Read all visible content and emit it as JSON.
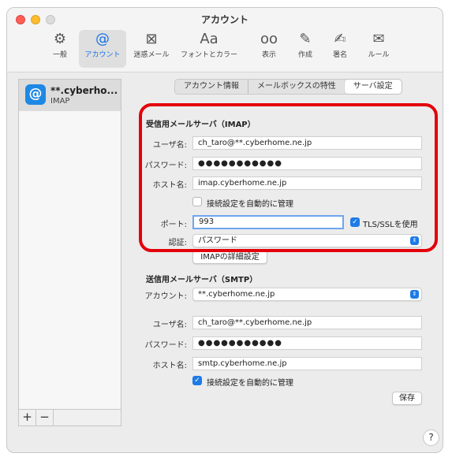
{
  "window": {
    "title": "アカウント"
  },
  "toolbar": {
    "items": [
      {
        "label": "一般",
        "icon": "gear-icon",
        "glyph": "⚙"
      },
      {
        "label": "アカウント",
        "icon": "at-icon",
        "glyph": "@"
      },
      {
        "label": "迷惑メール",
        "icon": "junk-mail-icon",
        "glyph": "⊠"
      },
      {
        "label": "フォントとカラー",
        "icon": "font-icon",
        "glyph": "Aa"
      },
      {
        "label": "表示",
        "icon": "glasses-icon",
        "glyph": "oo"
      },
      {
        "label": "作成",
        "icon": "compose-icon",
        "glyph": "✎"
      },
      {
        "label": "署名",
        "icon": "signature-icon",
        "glyph": "✍"
      },
      {
        "label": "ルール",
        "icon": "rules-icon",
        "glyph": "✉"
      }
    ],
    "active": "アカウント"
  },
  "sidebar": {
    "account": {
      "name": "**.cyberho...",
      "type": "IMAP",
      "icon_glyph": "@"
    },
    "add_label": "+",
    "remove_label": "−"
  },
  "tabs": {
    "info": "アカウント情報",
    "mailbox": "メールボックスの特性",
    "server": "サーバ設定",
    "active": "サーバ設定"
  },
  "incoming": {
    "title": "受信用メールサーバ（IMAP）",
    "username_label": "ユーザ名:",
    "username": "ch_taro@**.cyberhome.ne.jp",
    "password_label": "パスワード:",
    "password": "●●●●●●●●●●●",
    "host_label": "ホスト名:",
    "host": "imap.cyberhome.ne.jp",
    "auto_manage_label": "接続設定を自動的に管理",
    "auto_manage_checked": false,
    "port_label": "ポート:",
    "port": "993",
    "tls_label": "TLS/SSLを使用",
    "tls_checked": true,
    "auth_label": "認証:",
    "auth_value": "パスワード",
    "advanced_button": "IMAPの詳細設定"
  },
  "outgoing": {
    "title": "送信用メールサーバ（SMTP）",
    "account_label": "アカウント:",
    "account_value": "**.cyberhome.ne.jp",
    "username_label": "ユーザ名:",
    "username": "ch_taro@**.cyberhome.ne.jp",
    "password_label": "パスワード:",
    "password": "●●●●●●●●●●●",
    "host_label": "ホスト名:",
    "host": "smtp.cyberhome.ne.jp",
    "auto_manage_label": "接続設定を自動的に管理",
    "auto_manage_checked": true
  },
  "save_button": "保存",
  "help_label": "?",
  "colors": {
    "highlight": "#e3000b",
    "accent": "#1e7be6"
  }
}
